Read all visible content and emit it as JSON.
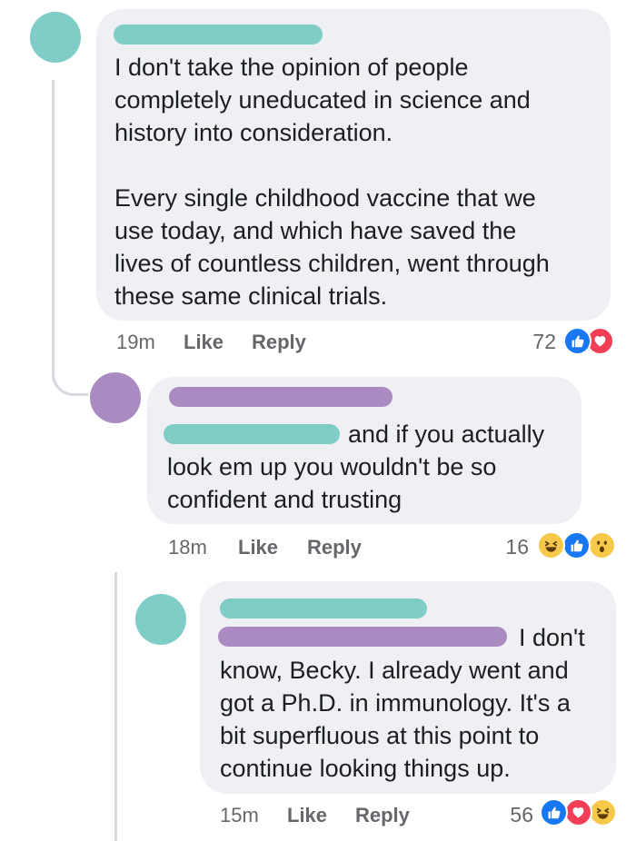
{
  "comments": [
    {
      "text": "I don't take the opinion of people\ncompletely uneducated in science and\nhistory into consideration.\n\nEvery single childhood vaccine that we\nuse today, and which have saved the\nlives of countless children, went through\nthese same clinical trials.",
      "time": "19m",
      "like_label": "Like",
      "reply_label": "Reply",
      "reaction_count": "72",
      "reactions": [
        "like-icon",
        "love-icon"
      ],
      "avatar_color": "#7fcdc6"
    },
    {
      "text_inline": "and if you actually",
      "text_rest": "look em up you wouldn't be so\nconfident and trusting",
      "time": "18m",
      "like_label": "Like",
      "reply_label": "Reply",
      "reaction_count": "16",
      "reactions": [
        "haha-icon",
        "like-icon",
        "wow-icon"
      ],
      "avatar_color": "#a98bc2"
    },
    {
      "text_inline": "I don't",
      "text_rest": "know, Becky. I already went and\ngot a Ph.D. in immunology. It's a\nbit superfluous at this point to\ncontinue looking things up.",
      "time": "15m",
      "like_label": "Like",
      "reply_label": "Reply",
      "reaction_count": "56",
      "reactions": [
        "like-icon",
        "love-icon",
        "haha-icon"
      ],
      "avatar_color": "#7fcdc6"
    }
  ],
  "colors": {
    "bubble": "#eef0f3",
    "redaction_teal": "#7fcdc6",
    "redaction_purple": "#a98bc2",
    "like_blue": "#1877f2",
    "love_red": "#f33e58",
    "emoji_yellow": "#f7c94b"
  }
}
